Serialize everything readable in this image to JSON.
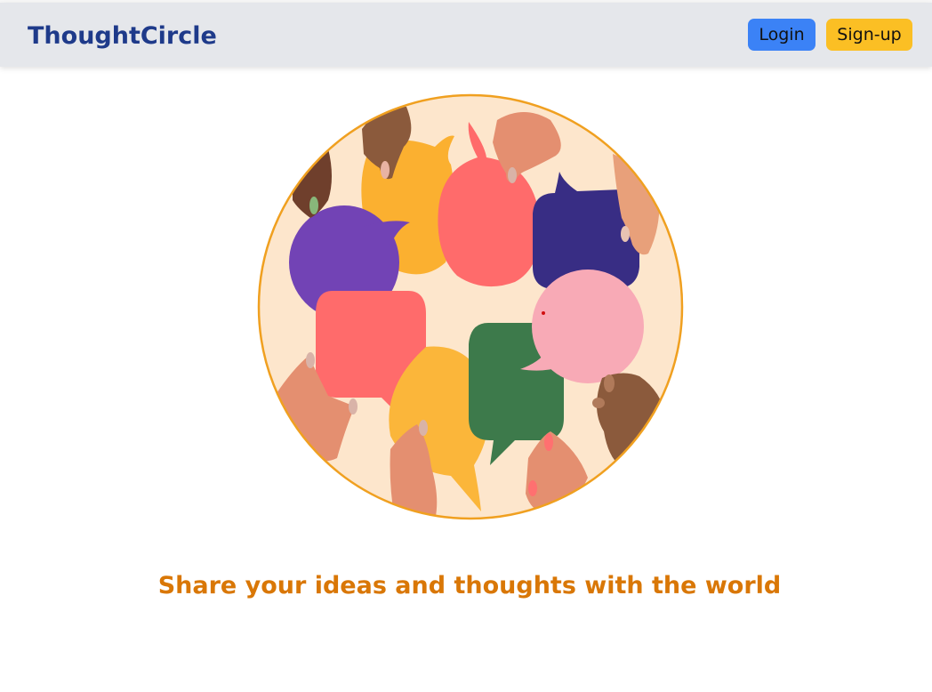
{
  "navbar": {
    "brand": "ThoughtCircle",
    "login_label": "Login",
    "signup_label": "Sign-up"
  },
  "hero": {
    "illustration": "hands-holding-speech-bubbles",
    "tagline": "Share your ideas and thoughts with the world"
  },
  "colors": {
    "navbar_bg": "#e5e7eb",
    "brand_text": "#1e3a8a",
    "login_button": "#3b82f6",
    "signup_button": "#fbbf24",
    "tagline_text": "#d97706",
    "circle_border": "#f0a020",
    "circle_bg": "#fde6cc"
  }
}
